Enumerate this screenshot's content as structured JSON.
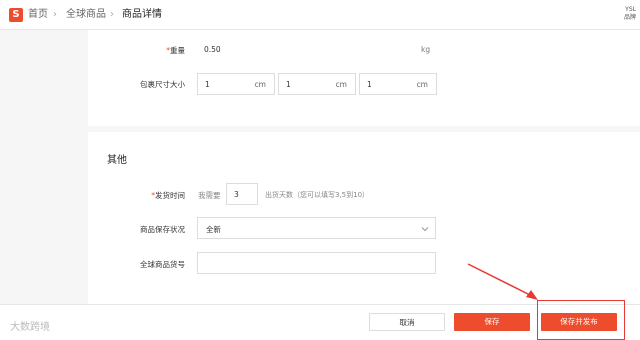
{
  "header": {
    "logo_glyph": "S",
    "breadcrumb": [
      "首页",
      "全球商品",
      "商品详情"
    ],
    "separator": "›",
    "user_line1": "YSL",
    "user_line2": "品牌"
  },
  "shipping": {
    "weight_label": "重量",
    "weight_value": "0.50",
    "weight_unit": "kg",
    "size_label": "包裹尺寸大小",
    "dims": [
      {
        "value": "1",
        "unit": "cm"
      },
      {
        "value": "1",
        "unit": "cm"
      },
      {
        "value": "1",
        "unit": "cm"
      }
    ]
  },
  "other": {
    "title": "其他",
    "ship_time_label": "发货时间",
    "ship_time_prefix": "我需要",
    "ship_time_value": "3",
    "ship_time_hint": "出货天数（您可以填写3,5到10）",
    "condition_label": "商品保存状况",
    "condition_value": "全新",
    "sku_label": "全球商品货号",
    "sku_value": ""
  },
  "footer": {
    "cancel_label": "取消",
    "save_label": "保存",
    "publish_label": "保存并发布"
  },
  "watermark": "大数跨境",
  "colors": {
    "brand": "#ee4d2d",
    "annotation": "#e53935"
  }
}
